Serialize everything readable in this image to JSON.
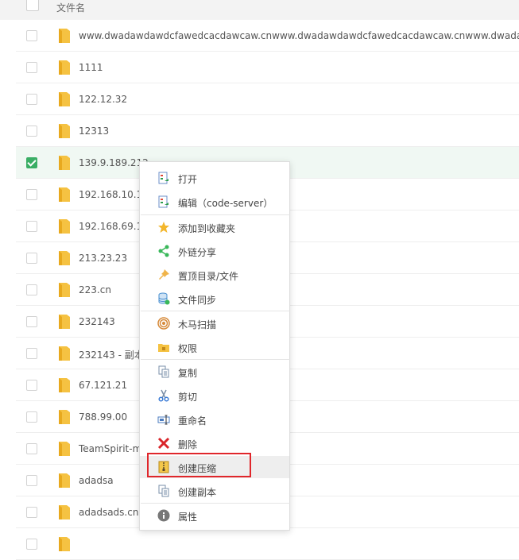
{
  "header": {
    "column_name": "文件名"
  },
  "files": [
    {
      "name": "www.dwadawdawdcfawedcacdawcaw.cnwww.dwadawdawdcfawedcacdawcaw.cnwww.dwadawda",
      "checked": false
    },
    {
      "name": "1111",
      "checked": false
    },
    {
      "name": "122.12.32",
      "checked": false
    },
    {
      "name": "12313",
      "checked": false
    },
    {
      "name": "139.9.189.212",
      "checked": true
    },
    {
      "name": "192.168.10.10",
      "checked": false
    },
    {
      "name": "192.168.69.18",
      "checked": false
    },
    {
      "name": "213.23.23",
      "checked": false
    },
    {
      "name": "223.cn",
      "checked": false
    },
    {
      "name": "232143",
      "checked": false
    },
    {
      "name": "232143 - 副本",
      "checked": false
    },
    {
      "name": "67.121.21",
      "checked": false
    },
    {
      "name": "788.99.00",
      "checked": false
    },
    {
      "name": "TeamSpirit-m",
      "checked": false
    },
    {
      "name": "adadsa",
      "checked": false
    },
    {
      "name": "adadsads.cn",
      "checked": false
    },
    {
      "name": "",
      "checked": false
    }
  ],
  "context_menu": {
    "items": [
      {
        "label": "打开",
        "icon": "open-file-icon"
      },
      {
        "label": "编辑（code-server）",
        "icon": "edit-file-icon"
      },
      {
        "label": "添加到收藏夹",
        "icon": "star-icon"
      },
      {
        "label": "外链分享",
        "icon": "share-icon"
      },
      {
        "label": "置顶目录/文件",
        "icon": "pin-icon"
      },
      {
        "label": "文件同步",
        "icon": "database-sync-icon"
      },
      {
        "label": "木马扫描",
        "icon": "scan-target-icon"
      },
      {
        "label": "权限",
        "icon": "folder-lock-icon"
      },
      {
        "label": "复制",
        "icon": "copy-icon"
      },
      {
        "label": "剪切",
        "icon": "scissors-icon"
      },
      {
        "label": "重命名",
        "icon": "rename-icon"
      },
      {
        "label": "删除",
        "icon": "delete-x-icon"
      },
      {
        "label": "创建压缩",
        "icon": "zip-archive-icon"
      },
      {
        "label": "创建副本",
        "icon": "duplicate-icon"
      },
      {
        "label": "属性",
        "icon": "info-icon"
      }
    ],
    "highlighted": "创建压缩"
  },
  "colors": {
    "accent_green": "#3aae65",
    "highlight_box": "#e0262b",
    "folder_yellow": "#f5c242"
  }
}
